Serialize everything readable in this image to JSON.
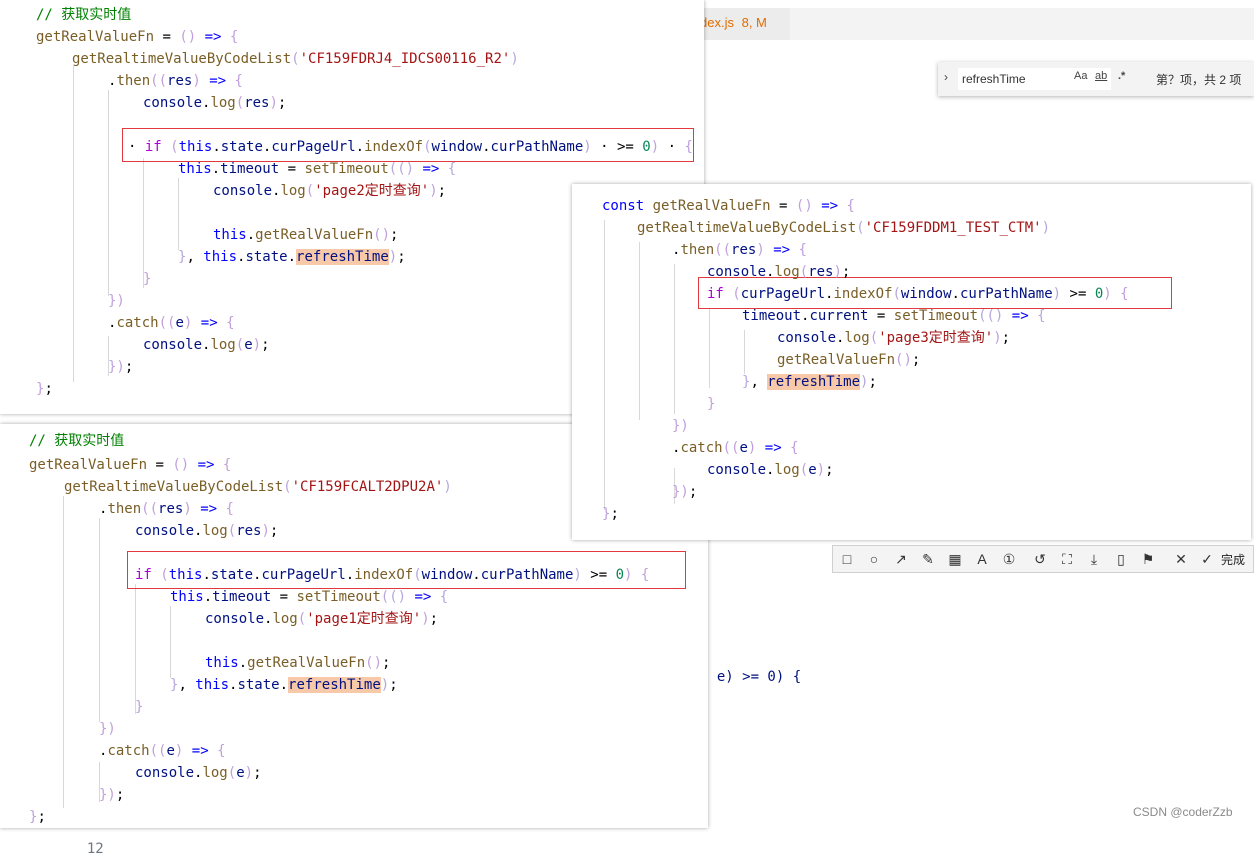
{
  "editor": {
    "tab_label": "dex.js",
    "tab_status": "8, M",
    "background_fragment": "e) >= 0) {",
    "background_fragment_2": "12"
  },
  "find_widget": {
    "query": "refreshTime",
    "match_case": "Aa",
    "whole_word": "ab",
    "regex": ".*",
    "result": "第？项，共 2 项"
  },
  "snip_toolbar": {
    "tools": [
      "rectangle-icon",
      "ellipse-icon",
      "arrow-icon",
      "pen-icon",
      "mosaic-icon",
      "text-icon",
      "number-icon",
      "undo-icon",
      "ocr-icon",
      "download-icon",
      "copy-icon",
      "pin-icon",
      "close-icon"
    ],
    "done_label": "完成"
  },
  "watermark": "CSDN @coderZzb",
  "snippets": {
    "a": {
      "comment": "// 获取实时值",
      "fn_name": "getRealValueFn",
      "call": "getRealtimeValueByCodeList",
      "code": "'CF159FDRJ4_IDCS00116_R2'",
      "log_text": "'page2定时查询'",
      "refresh": "refreshTime"
    },
    "b": {
      "fn_name": "getRealValueFn",
      "call": "getRealtimeValueByCodeList",
      "code": "'CF159FDDM1_TEST_CTM'",
      "log_text": "'page3定时查询'",
      "refresh": "refreshTime"
    },
    "c": {
      "comment": "// 获取实时值",
      "fn_name": "getRealValueFn",
      "call": "getRealtimeValueByCodeList",
      "code": "'CF159FCALT2DPU2A'",
      "log_text": "'page1定时查询'",
      "refresh": "refreshTime"
    }
  }
}
